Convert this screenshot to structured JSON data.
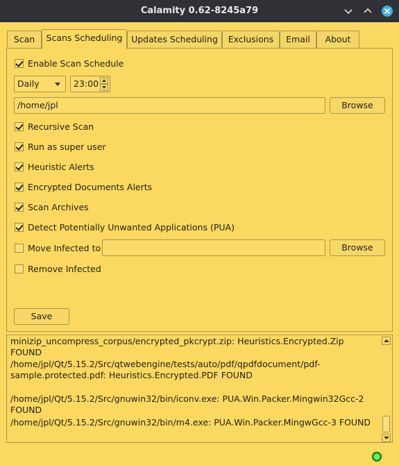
{
  "window": {
    "title": "Calamity 0.62-8245a79"
  },
  "tabs": [
    {
      "label": "Scan",
      "active": false
    },
    {
      "label": "Scans Scheduling",
      "active": true
    },
    {
      "label": "Updates Scheduling",
      "active": false
    },
    {
      "label": "Exclusions",
      "active": false
    },
    {
      "label": "Email",
      "active": false
    },
    {
      "label": "About",
      "active": false
    }
  ],
  "schedule": {
    "enable_label": "Enable Scan Schedule",
    "enable_checked": true,
    "frequency": "Daily",
    "time": "23:00",
    "path": "/home/jpl",
    "browse_label": "Browse",
    "options": [
      {
        "label": "Recursive Scan",
        "checked": true
      },
      {
        "label": "Run as super user",
        "checked": true
      },
      {
        "label": "Heuristic Alerts",
        "checked": true
      },
      {
        "label": "Encrypted Documents Alerts",
        "checked": true
      },
      {
        "label": "Scan Archives",
        "checked": true
      },
      {
        "label": "Detect Potentially Unwanted Applications (PUA)",
        "checked": true
      }
    ],
    "move_infected_label": "Move Infected to",
    "move_infected_checked": false,
    "move_infected_path": "",
    "move_browse_label": "Browse",
    "remove_infected_label": "Remove Infected",
    "remove_infected_checked": false,
    "save_label": "Save"
  },
  "log": [
    "minizip_uncompress_corpus/encrypted_pkcrypt.zip: Heuristics.Encrypted.Zip FOUND",
    "/home/jpl/Qt/5.15.2/Src/qtwebengine/tests/auto/pdf/qpdfdocument/pdf-sample.protected.pdf: Heuristics.Encrypted.PDF FOUND",
    "/home/jpl/Qt/5.15.2/Src/gnuwin32/bin/iconv.exe: PUA.Win.Packer.Mingwin32Gcc-2 FOUND",
    "/home/jpl/Qt/5.15.2/Src/gnuwin32/bin/m4.exe: PUA.Win.Packer.MingwGcc-3 FOUND"
  ],
  "colors": {
    "background": "#fbd85f",
    "titlebar": "#2f3136",
    "close_button": "#3daee9",
    "status_led": "#1fbf1f"
  },
  "icons": {
    "minimize": "chevron-down-icon",
    "maximize": "chevron-up-icon",
    "close": "close-icon",
    "status": "status-led-icon"
  }
}
